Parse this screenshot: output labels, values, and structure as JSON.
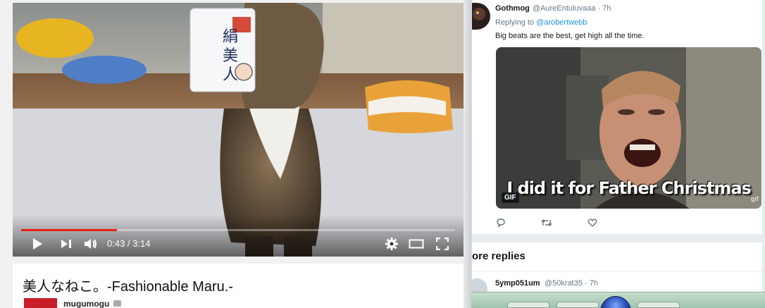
{
  "video": {
    "time_display": "0:43 / 3:14",
    "progress": 0.22,
    "title": "美人なねこ。-Fashionable Maru.-",
    "channel": "mugumogu"
  },
  "tweet": {
    "author_name": "Gothmog",
    "author_handle": "@AureEntuluvaaa · 7h",
    "replying_prefix": "Replying to",
    "replying_user": "@arobertwebb",
    "text": "Big beats are the best, get high all the time.",
    "gif_caption": "I did it for Father Christmas",
    "gif_badge": "GIF",
    "gif_watermark": "gif"
  },
  "more_replies": {
    "heading": "ore replies",
    "reply2_name": "5ymp051um",
    "reply2_handle": "@50krat35 · 7h"
  },
  "colors": {
    "progress_red": "#e62117",
    "twitter_blue": "#1b95e0",
    "muted": "#657786"
  }
}
